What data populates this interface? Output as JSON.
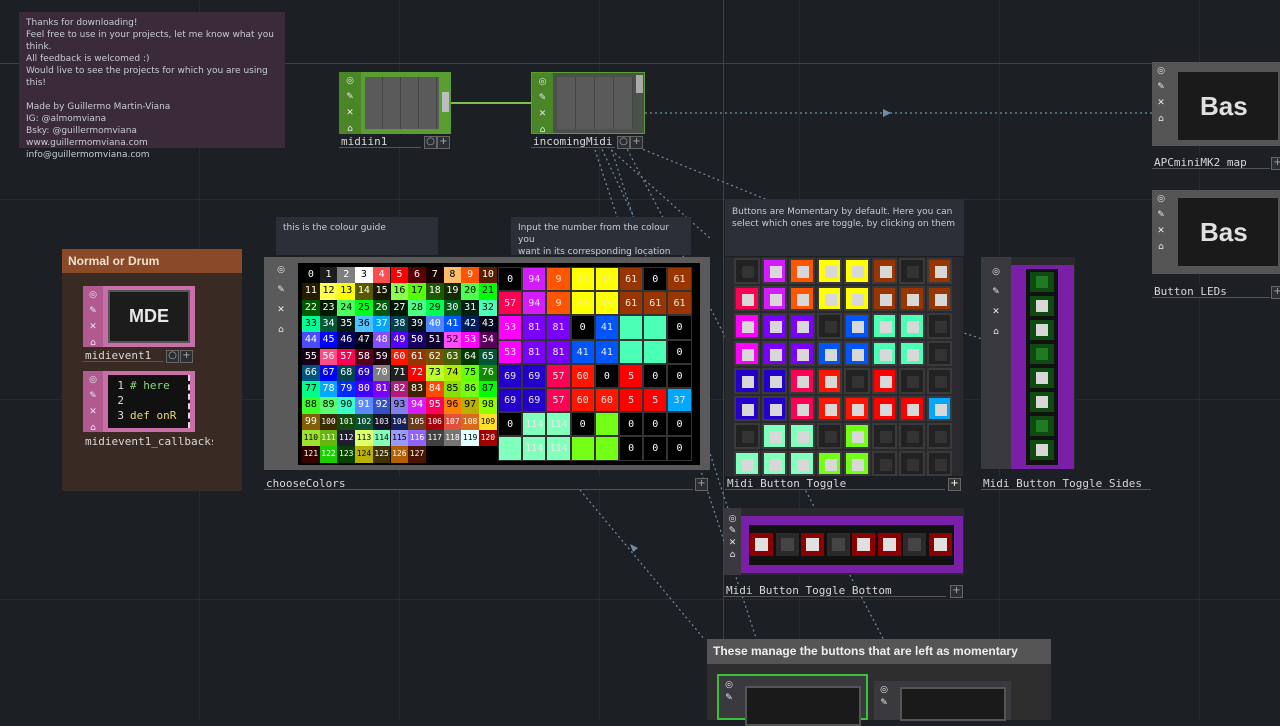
{
  "notes": {
    "intro": "Thanks for downloading!\nFeel free to use in your projects, let me know what you think.\nAll feedback is welcomed :)\nWould live to see the projects for which you are using this!\n\nMade by Guillermo Martin-Viana\nIG: @almomviana\nBsky: @guillermomviana\nwww.guillermomviana.com\ninfo@guillermomviana.com",
    "colour_guide": "this is the colour guide",
    "input_number": "Input the number from the colour you\nwant in its corresponding location",
    "momentary": "Buttons are Momentary by default. Here you can\nselect which ones are toggle, by clicking on them",
    "manage": "These manage the buttons that are left as momentary"
  },
  "annotation": {
    "normal_or_drum": "Normal or Drum"
  },
  "nodes": {
    "midiin1": "midiin1",
    "incomingMidi": "incomingMidi",
    "apc_map": "APCminiMK2_map",
    "button_leds": "Button_LEDs",
    "midievent1": "midievent1",
    "midievent1_callbacks": "midievent1_callbacks",
    "chooseColors": "chooseColors",
    "midi_button_toggle": "Midi_Button_Toggle",
    "midi_button_toggle_sides": "Midi_Button_Toggle_Sides",
    "midi_button_toggle_bottom": "Midi_Button_Toggle_Bottom"
  },
  "viewers": {
    "mde": "MDE",
    "bas_1": "Bas",
    "bas_2": "Bas",
    "code_lines": [
      "1",
      "2",
      "3"
    ],
    "code_text": [
      "# here",
      "",
      "def onR"
    ]
  },
  "side_icons": [
    "target-icon",
    "pencil-icon",
    "close-icon",
    "lock-icon"
  ],
  "colour_guide_cells": [
    [
      "0",
      "1",
      "2",
      "3",
      "4",
      "5",
      "6",
      "7",
      "8",
      "9",
      "10"
    ],
    [
      "11",
      "12",
      "13",
      "14",
      "15",
      "16",
      "17",
      "18",
      "19",
      "20",
      "21"
    ],
    [
      "22",
      "23",
      "24",
      "25",
      "26",
      "27",
      "28",
      "29",
      "30",
      "31",
      "32"
    ],
    [
      "33",
      "34",
      "35",
      "36",
      "37",
      "38",
      "39",
      "40",
      "41",
      "42",
      "43"
    ],
    [
      "44",
      "45",
      "46",
      "47",
      "48",
      "49",
      "50",
      "51",
      "52",
      "53",
      "54"
    ],
    [
      "55",
      "56",
      "57",
      "58",
      "59",
      "60",
      "61",
      "62",
      "63",
      "64",
      "65"
    ],
    [
      "66",
      "67",
      "68",
      "69",
      "70",
      "71",
      "72",
      "73",
      "74",
      "75",
      "76"
    ],
    [
      "77",
      "78",
      "79",
      "80",
      "81",
      "82",
      "83",
      "84",
      "85",
      "86",
      "87"
    ],
    [
      "88",
      "89",
      "90",
      "91",
      "92",
      "93",
      "94",
      "95",
      "96",
      "97",
      "98"
    ],
    [
      "99",
      "100",
      "101",
      "102",
      "103",
      "104",
      "105",
      "106",
      "107",
      "108",
      "109"
    ],
    [
      "110",
      "111",
      "112",
      "113",
      "114",
      "115",
      "116",
      "117",
      "118",
      "119",
      "120"
    ],
    [
      "121",
      "122",
      "123",
      "124",
      "125",
      "126",
      "127",
      "",
      "",
      "",
      ""
    ]
  ],
  "colour_guide_colors": [
    [
      "#000000",
      "#1e1e1e",
      "#7f7f7f",
      "#ffffff",
      "#ff4c4c",
      "#ff0000",
      "#590000",
      "#190000",
      "#ffbd6c",
      "#ff5400",
      "#591d00"
    ],
    [
      "#271b00",
      "#ffff4c",
      "#ffff00",
      "#595900",
      "#191900",
      "#88ff4c",
      "#54ff00",
      "#1d5900",
      "#142b00",
      "#4cff4c",
      "#00ff00"
    ],
    [
      "#005900",
      "#001900",
      "#4cff5e",
      "#00ff19",
      "#00590d",
      "#001902",
      "#4cff88",
      "#00ff55",
      "#00591d",
      "#001f12",
      "#4cffb7"
    ],
    [
      "#00ff99",
      "#005935",
      "#001912",
      "#4cc3ff",
      "#00a9ff",
      "#004152",
      "#001019",
      "#4c88ff",
      "#0055ff",
      "#001d59",
      "#000819"
    ],
    [
      "#4c4cff",
      "#0000ff",
      "#000059",
      "#000019",
      "#874cff",
      "#5400ff",
      "#190064",
      "#0f0030",
      "#ff4cff",
      "#ff00ff",
      "#590059"
    ],
    [
      "#190019",
      "#ff4c87",
      "#ff0054",
      "#59001d",
      "#220013",
      "#ff1500",
      "#993500",
      "#795100",
      "#436400",
      "#033900",
      "#005735"
    ],
    [
      "#00547f",
      "#0000ff",
      "#00454f",
      "#2500cc",
      "#7f7f7f",
      "#202020",
      "#ff0000",
      "#bdff2d",
      "#afed06",
      "#64ff09",
      "#108b00"
    ],
    [
      "#00ff87",
      "#00a9ff",
      "#002aff",
      "#3f00ff",
      "#7a00ff",
      "#b21a7d",
      "#402100",
      "#ff4a00",
      "#88e106",
      "#72ff15",
      "#00ff00"
    ],
    [
      "#3bff26",
      "#59ff71",
      "#38ffcc",
      "#5b8aff",
      "#3151c6",
      "#877fe9",
      "#d31dff",
      "#ff005d",
      "#ff7f00",
      "#b9b000",
      "#90ff00"
    ],
    [
      "#835d07",
      "#392b00",
      "#144c10",
      "#0d5038",
      "#15152a",
      "#16205a",
      "#693c1c",
      "#a8000a",
      "#de513d",
      "#d86a1c",
      "#ffe126"
    ],
    [
      "#9ee12f",
      "#67b50f",
      "#1e1e30",
      "#dcff6b",
      "#80ffbd",
      "#9a99ff",
      "#8e66ff",
      "#404040",
      "#757575",
      "#e0ffff",
      "#a00000"
    ],
    [
      "#350000",
      "#1ad000",
      "#074200",
      "#b9b000",
      "#3f3100",
      "#b35f00",
      "#4b1502",
      "#000000",
      "#000000",
      "#000000",
      "#000000"
    ]
  ],
  "input_grid_values": [
    [
      "0",
      "94",
      "9",
      "13",
      "13",
      "61",
      "0",
      "61"
    ],
    [
      "57",
      "94",
      "9",
      "13",
      "13",
      "61",
      "61",
      "61"
    ],
    [
      "53",
      "81",
      "81",
      "0",
      "41",
      "",
      "",
      "0"
    ],
    [
      "53",
      "81",
      "81",
      "41",
      "41",
      "",
      "",
      "0"
    ],
    [
      "69",
      "69",
      "57",
      "60",
      "0",
      "5",
      "0",
      "0"
    ],
    [
      "69",
      "69",
      "57",
      "60",
      "60",
      "5",
      "5",
      "37"
    ],
    [
      "0",
      "114",
      "114",
      "0",
      "",
      "0",
      "0",
      "0"
    ],
    [
      "",
      "114",
      "114",
      "",
      "",
      "0",
      "0",
      "0"
    ]
  ],
  "input_grid_colors": [
    [
      "#000000",
      "#d31dff",
      "#ff5400",
      "#ffff00",
      "#ffff00",
      "#993500",
      "#000000",
      "#993500"
    ],
    [
      "#ff0054",
      "#d31dff",
      "#ff5400",
      "#ffff00",
      "#ffff00",
      "#993500",
      "#993500",
      "#993500"
    ],
    [
      "#ff00ff",
      "#7a00ff",
      "#7a00ff",
      "#000000",
      "#0055ff",
      "#4cffb7",
      "#4cffb7",
      "#000000"
    ],
    [
      "#ff00ff",
      "#7a00ff",
      "#7a00ff",
      "#0055ff",
      "#0055ff",
      "#4cffb7",
      "#4cffb7",
      "#000000"
    ],
    [
      "#2500cc",
      "#2500cc",
      "#ff0054",
      "#ff1500",
      "#000000",
      "#ff0000",
      "#000000",
      "#000000"
    ],
    [
      "#2500cc",
      "#2500cc",
      "#ff0054",
      "#ff1500",
      "#ff1500",
      "#ff0000",
      "#ff0000",
      "#00a9ff"
    ],
    [
      "#000000",
      "#80ffbd",
      "#80ffbd",
      "#000000",
      "#72ff15",
      "#000000",
      "#000000",
      "#000000"
    ],
    [
      "#80ffbd",
      "#80ffbd",
      "#80ffbd",
      "#72ff15",
      "#72ff15",
      "#000000",
      "#000000",
      "#000000"
    ]
  ],
  "colors": {
    "accent_green": "#5a9e32",
    "node_pink": "#c76fa6",
    "purple_frame": "#7a1fa8",
    "annotation_header": "#8a4a28",
    "annotation_body": "#3a2a24",
    "note_bg": "#3a2a3a"
  }
}
